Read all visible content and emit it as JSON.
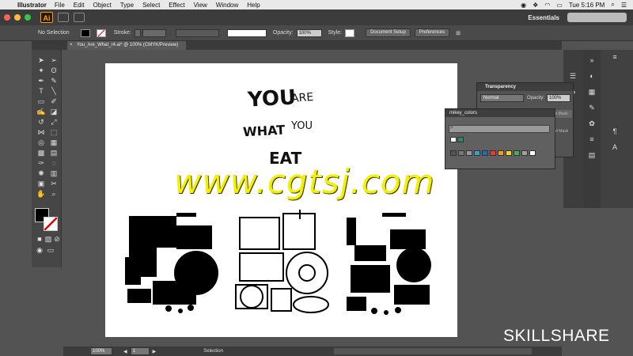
{
  "menubar": {
    "app_name": "Illustrator",
    "items": [
      "File",
      "Edit",
      "Object",
      "Type",
      "Select",
      "Effect",
      "View",
      "Window",
      "Help"
    ],
    "clock": "Tue 5:16 PM"
  },
  "appbar": {
    "logo": "Ai",
    "workspace": "Essentials"
  },
  "control": {
    "selection": "No Selection",
    "stroke_label": "Stroke:",
    "opacity_label": "Opacity:",
    "opacity_value": "100%",
    "style_label": "Style:",
    "doc_setup": "Document Setup",
    "preferences": "Preferences",
    "accent": "#f0a030"
  },
  "document": {
    "tab_title": "You_Are_What_r4.ai* @ 100% (CMYK/Preview)"
  },
  "artwork": {
    "line1_a": "YOU",
    "line1_b": "ARE",
    "line2_a": "WHAT",
    "line2_b": "YOU",
    "line3": "EAT"
  },
  "transparency_panel": {
    "title": "Transparency",
    "blend_mode": "Normal",
    "opacity_label": "Opacity:",
    "opacity_value": "100%",
    "make_mask": "ke Mask",
    "invert_mask": "ert Mask"
  },
  "swatches_panel": {
    "title": "mikey_colors",
    "colors": [
      "#ffffff",
      "#2e8b57",
      "#555555",
      "#777777",
      "#999999",
      "#3aa0c8",
      "#1f6fb0",
      "#e23b3b",
      "#f29b1d",
      "#f5d130",
      "#48b04f",
      "#a0a0a0",
      "#ffffff"
    ]
  },
  "statusbar": {
    "zoom": "100%",
    "page": "1",
    "tool": "Selection"
  },
  "overlay": {
    "brand": "SKILLSHARE",
    "watermark": "www.cgtsj.com"
  }
}
